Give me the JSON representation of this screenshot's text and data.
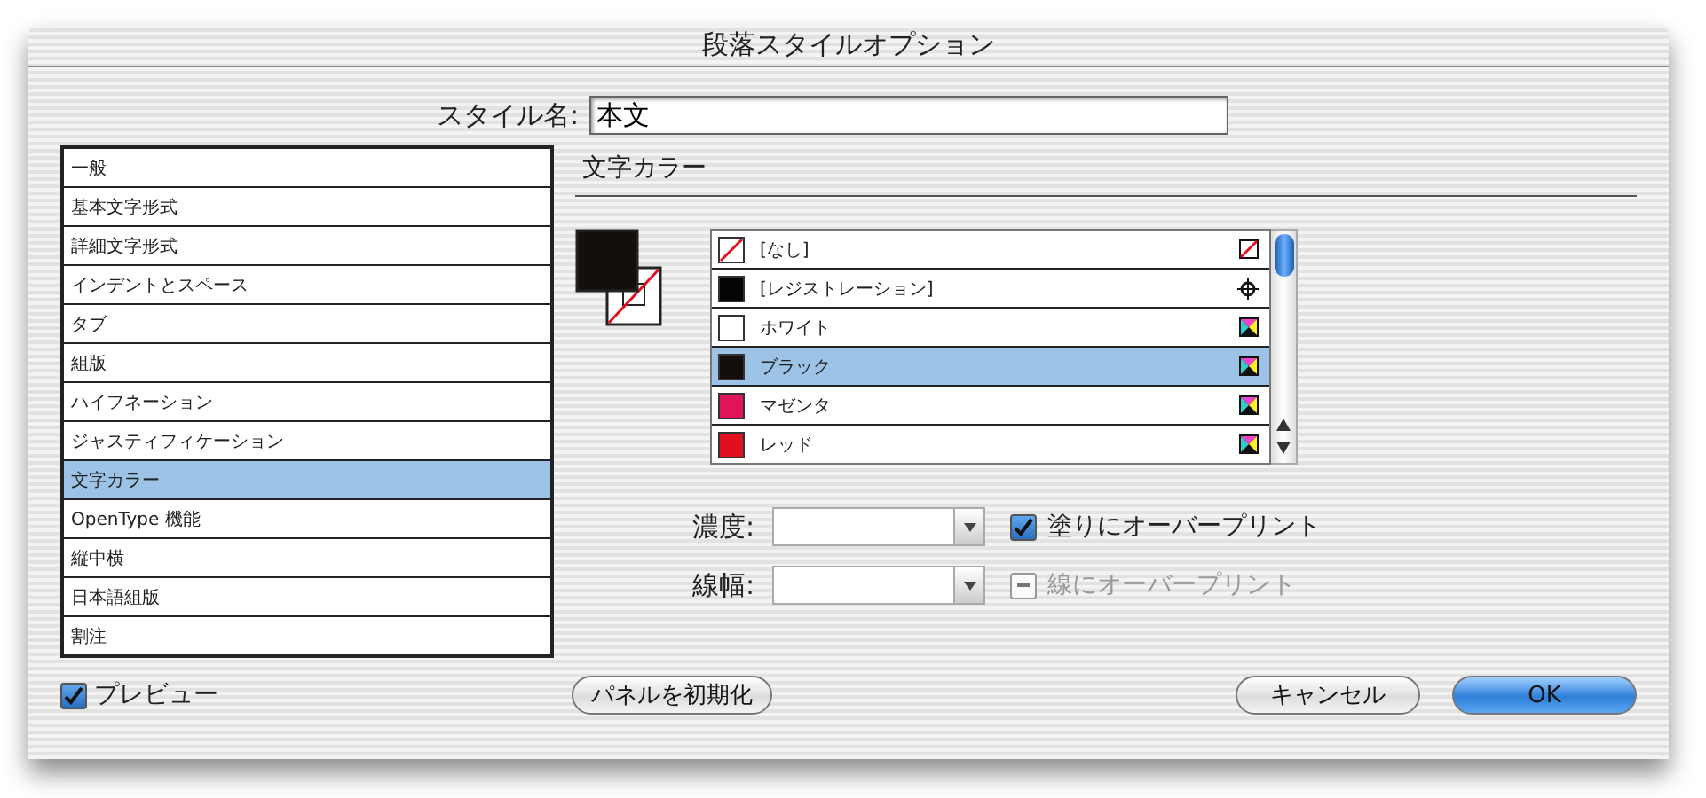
{
  "window": {
    "title": "段落スタイルオプション"
  },
  "style_name": {
    "label": "スタイル名:",
    "value": "本文"
  },
  "sidebar": {
    "items": [
      {
        "label": "一般",
        "selected": false
      },
      {
        "label": "基本文字形式",
        "selected": false
      },
      {
        "label": "詳細文字形式",
        "selected": false
      },
      {
        "label": "インデントとスペース",
        "selected": false
      },
      {
        "label": "タブ",
        "selected": false
      },
      {
        "label": "組版",
        "selected": false
      },
      {
        "label": "ハイフネーション",
        "selected": false
      },
      {
        "label": "ジャスティフィケーション",
        "selected": false
      },
      {
        "label": "文字カラー",
        "selected": true
      },
      {
        "label": "OpenType 機能",
        "selected": false
      },
      {
        "label": "縦中横",
        "selected": false
      },
      {
        "label": "日本語組版",
        "selected": false
      },
      {
        "label": "割注",
        "selected": false
      }
    ]
  },
  "panel": {
    "title": "文字カラー"
  },
  "swatches": [
    {
      "name": "[なし]",
      "kind": "none",
      "selected": false
    },
    {
      "name": "[レジストレーション]",
      "kind": "registration",
      "color": "#050505",
      "selected": false
    },
    {
      "name": "ホワイト",
      "kind": "process",
      "color": "#ffffff",
      "selected": false
    },
    {
      "name": "ブラック",
      "kind": "process",
      "color": "#140e0c",
      "selected": true
    },
    {
      "name": "マゼンタ",
      "kind": "process",
      "color": "#e0145a",
      "selected": false
    },
    {
      "name": "レッド",
      "kind": "process",
      "color": "#e01020",
      "selected": false
    }
  ],
  "tint": {
    "label": "濃度:"
  },
  "weight": {
    "label": "線幅:"
  },
  "overprint_fill": {
    "label": "塗りにオーバープリント",
    "checked": true,
    "disabled": false
  },
  "overprint_stroke": {
    "label": "線にオーバープリント",
    "indeterminate": true,
    "disabled": true
  },
  "preview": {
    "label": "プレビュー",
    "checked": true
  },
  "buttons": {
    "reset": "パネルを初期化",
    "cancel": "キャンセル",
    "ok": "OK"
  }
}
